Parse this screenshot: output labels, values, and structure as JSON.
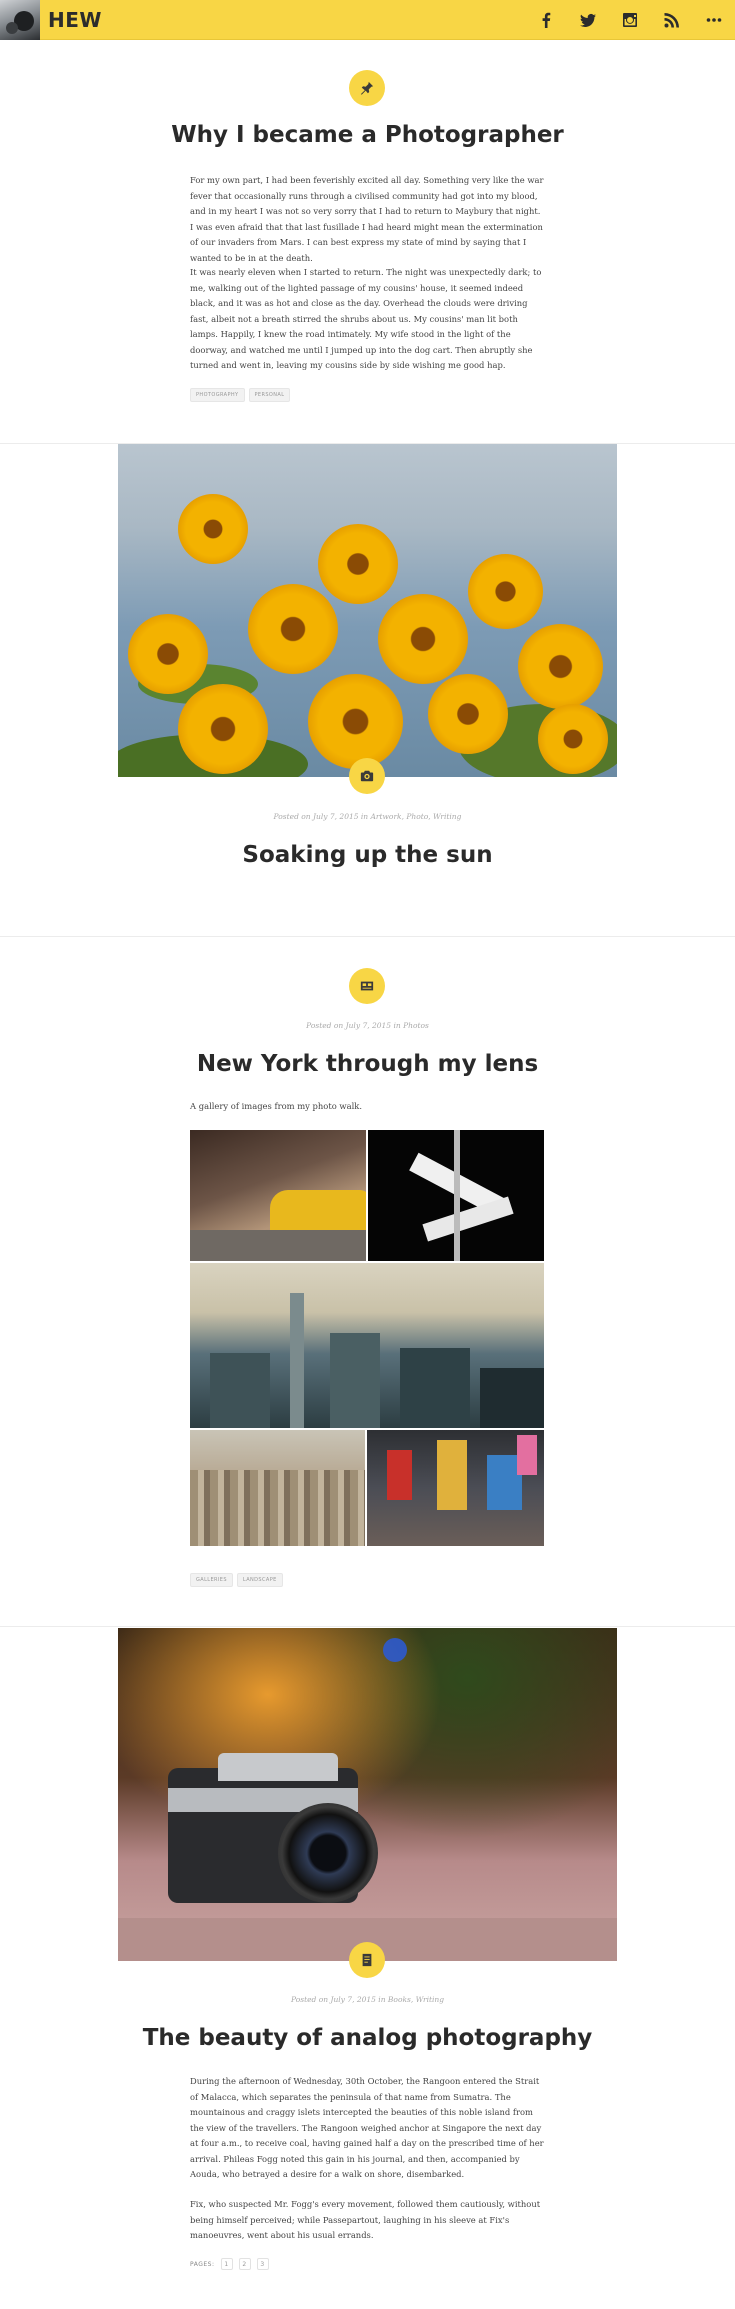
{
  "header": {
    "site_title": "HEW",
    "social_icons": [
      "facebook-icon",
      "twitter-icon",
      "instagram-icon",
      "rss-icon",
      "more-icon"
    ],
    "accent_color": "#f8d645"
  },
  "posts": [
    {
      "type_icon": "pin-icon",
      "title": "Why I became a Photographer",
      "paragraphs": [
        "For my own part, I had been feverishly excited all day. Something very like the war fever that occasionally runs through a civilised community had got into my blood, and in my heart I was not so very sorry that I had to return to Maybury that night. I was even afraid that that last fusillade I had heard might mean the extermination of our invaders from Mars. I can best express my state of mind by saying that I wanted to be in at the death.",
        "It was nearly eleven when I started to return. The night was unexpectedly dark; to me, walking out of the lighted passage of my cousins' house, it seemed indeed black, and it was as hot and close as the day. Overhead the clouds were driving fast, albeit not a breath stirred the shrubs about us. My cousins' man lit both lamps. Happily, I knew the road intimately. My wife stood in the light of the doorway, and watched me until I jumped up into the dog cart. Then abruptly she turned and went in, leaving my cousins side by side wishing me good hap."
      ],
      "tags": [
        "PHOTOGRAPHY",
        "PERSONAL"
      ]
    },
    {
      "type_icon": "camera-icon",
      "meta": "Posted on July 7, 2015 in Artwork, Photo, Writing",
      "title": "Soaking up the sun"
    },
    {
      "type_icon": "gallery-icon",
      "meta": "Posted on July 7, 2015 in Photos",
      "title": "New York through my lens",
      "intro": "A gallery of images from my photo walk.",
      "tags": [
        "GALLERIES",
        "LANDSCAPE"
      ]
    },
    {
      "type_icon": "note-icon",
      "meta": "Posted on July 7, 2015 in Books, Writing",
      "title": "The beauty of analog photography",
      "paragraphs": [
        "During the afternoon of Wednesday, 30th October, the Rangoon entered the Strait of Malacca, which separates the peninsula of that name from Sumatra. The mountainous and craggy islets intercepted the beauties of this noble island from the view of the travellers. The Rangoon weighed anchor at Singapore the next day at four a.m., to receive coal, having gained half a day on the prescribed time of her arrival. Phileas Fogg noted this gain in his journal, and then, accompanied by Aouda, who betrayed a desire for a walk on shore, disembarked.",
        "Fix, who suspected Mr. Fogg's every movement, followed them cautiously, without being himself perceived; while Passepartout, laughing in his sleeve at Fix's manoeuvres, went about his usual errands."
      ],
      "pages_label": "PAGES:",
      "pages": [
        "1",
        "2",
        "3"
      ]
    }
  ]
}
